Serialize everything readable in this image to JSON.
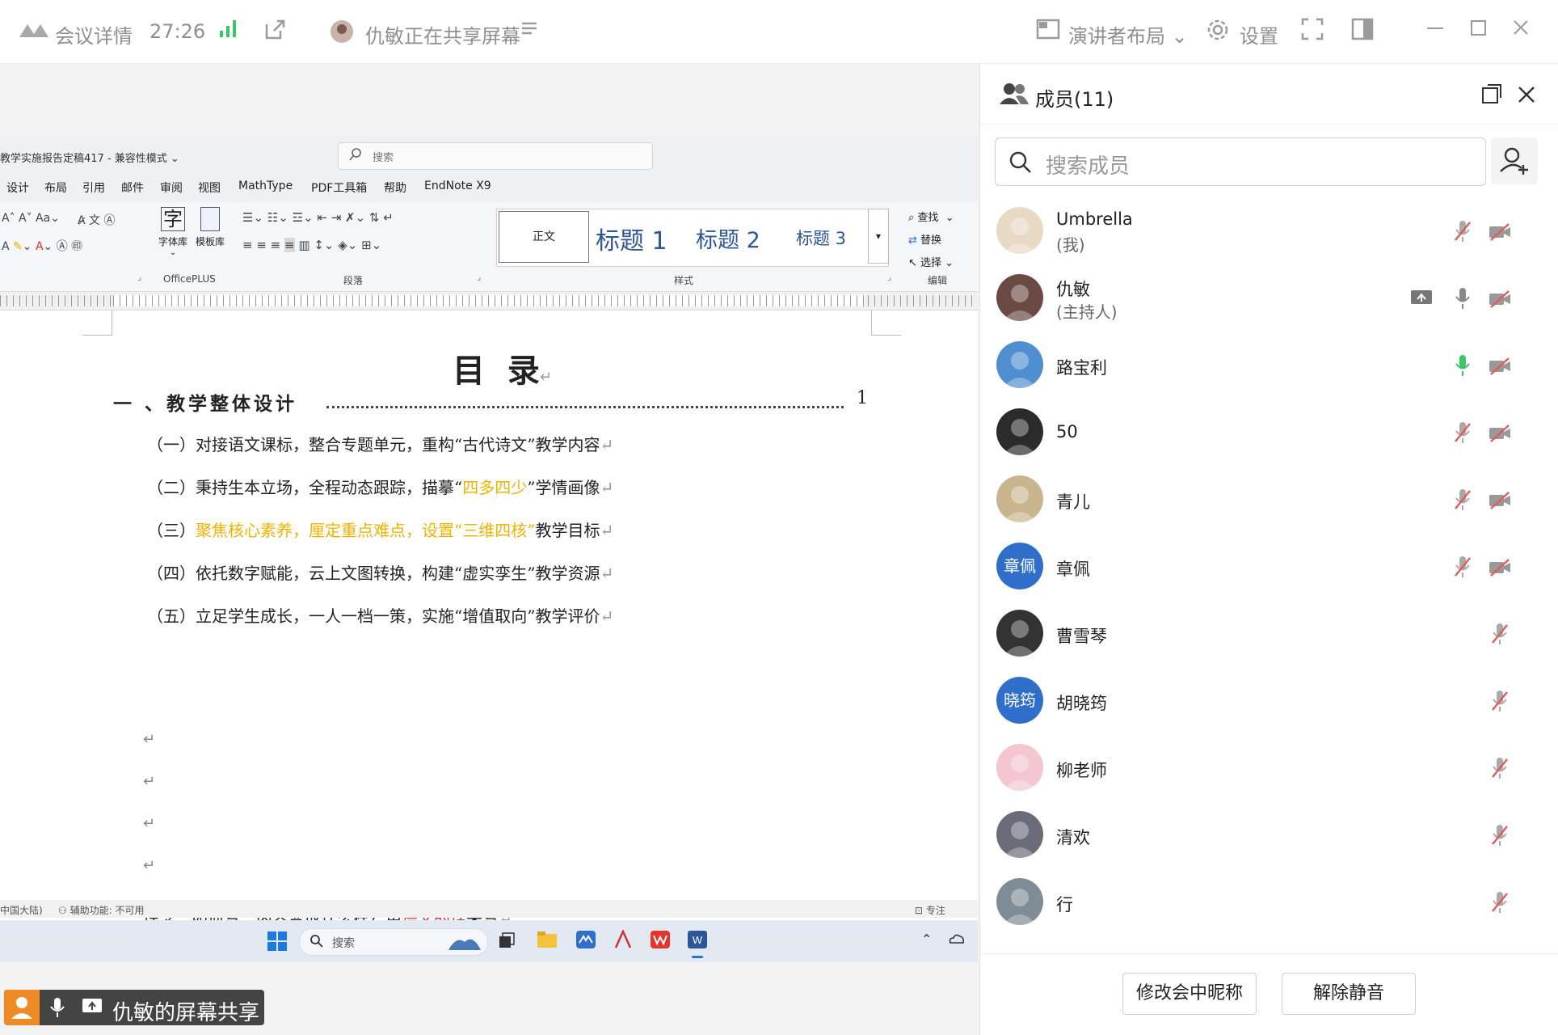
{
  "titlebar": {
    "meeting_details": "会议详情",
    "timer": "27:26",
    "sharing_status": "仇敏正在共享屏幕",
    "layout_label": "演讲者布局",
    "settings_label": "设置"
  },
  "word": {
    "doc_title": "教学实施报告定稿417 - 兼容性模式",
    "search_placeholder": "搜索",
    "menu": [
      "设计",
      "布局",
      "引用",
      "邮件",
      "审阅",
      "视图",
      "MathType",
      "PDF工具箱",
      "帮助",
      "EndNote X9"
    ],
    "ribbon": {
      "font_lib": "字体库",
      "template_lib": "模板库",
      "officeplus": "OfficePLUS",
      "paragraph": "段落",
      "styles": "样式",
      "style_normal": "正文",
      "style_h1": "标题 1",
      "style_h2": "标题 2",
      "style_h3": "标题 3",
      "find": "查找",
      "replace": "替换",
      "select": "选择",
      "edit": "编辑"
    },
    "doc": {
      "heading": "目  录",
      "toc1_text": "一 、教学整体设计",
      "toc1_page": "1",
      "items": [
        {
          "pre": "（一）对接语文课标，整合专题单元，重构“古代诗文”教学内容",
          "hl": "",
          "post": ""
        },
        {
          "pre": "（二）秉持生本立场，全程动态跟踪，描摹“",
          "hl": "四多四少",
          "post": "”学情画像"
        },
        {
          "pre": "（三）",
          "hl": "聚焦核心素养，厘定重点难点，设置“三维四核”",
          "post": "教学目标"
        },
        {
          "pre": "（四）依托数字赋能，云上文图转换，构建“虚实孪生”教学资源",
          "hl": "",
          "post": ""
        },
        {
          "pre": "（五）立足学生成长，一人一档一策，实施“增值取向”教学评价",
          "hl": "",
          "post": ""
        }
      ],
      "last_pre": "理念、如何写、内容变成什么样？用",
      "last_red": "语文的话",
      "last_post": "来写"
    },
    "status": {
      "lang": "中国大陆)",
      "accessibility": "辅助功能: 不可用",
      "focus": "专注"
    },
    "taskbar_search": "搜索"
  },
  "share_label": "仇敏的屏幕共享",
  "members_panel": {
    "title": "成员(11)",
    "search_placeholder": "搜索成员",
    "members": [
      {
        "name": "Umbrella",
        "role": "(我)"
      },
      {
        "name": "仇敏",
        "role": "(主持人)"
      },
      {
        "name": "路宝利",
        "role": ""
      },
      {
        "name": "50",
        "role": ""
      },
      {
        "name": "青儿",
        "role": ""
      },
      {
        "name": "章佩",
        "role": "",
        "avatar_text": "章佩"
      },
      {
        "name": "曹雪琴",
        "role": ""
      },
      {
        "name": "胡晓筠",
        "role": "",
        "avatar_text": "晓筠"
      },
      {
        "name": "柳老师",
        "role": ""
      },
      {
        "name": "清欢",
        "role": ""
      },
      {
        "name": "行",
        "role": ""
      }
    ],
    "rename_button": "修改会中昵称",
    "unmute_button": "解除静音"
  },
  "colors": {
    "accent_blue": "#2f6fca",
    "highlight_yellow": "#f0b400",
    "red_text": "#d0332a",
    "mic_active_green": "#3cc46b",
    "muted_red": "#e25a5a"
  }
}
